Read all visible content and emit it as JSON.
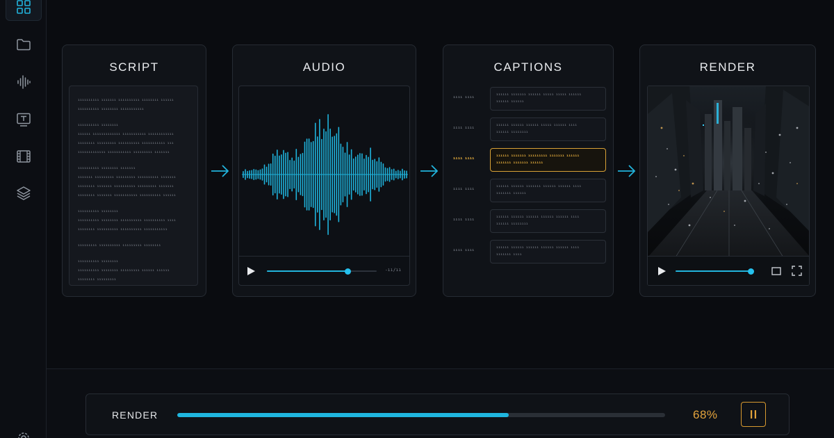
{
  "sidebar": {
    "icons": [
      "grid-icon",
      "folder-icon",
      "waveform-icon",
      "text-icon",
      "film-icon",
      "layers-icon",
      "gear-icon"
    ]
  },
  "stages": {
    "script": {
      "title": "SCRIPT",
      "lines": [
        "ıııııııııı ııııııı ıııııııııı ıııııııı ıııııı",
        "ıııııııııı ıııııııı ııııııııııı",
        "",
        "ıııııııııı ıııııııı",
        "ıııııı ııııııııııııı ııııııııııı ıııııııııııı",
        "ıııııııı ııııııııı ıııııııııı ııııııııııı ııı",
        "ııııııııııııı ııııııııııı ııııııııı ııııııı",
        "",
        "ıııııııııı ıııııııı ııııııı",
        "ııııııı ııııııııı ııııııııı ıııııııııı ııııııı",
        "ıııııııı ııııııı ıııııııııı ııııııııı ııııııı",
        "ıııııııı ııııııı ııııııııııı ıııııııııı ıııııı",
        "",
        "ıııııııııı ıııııııı",
        "ıııııııııı ıııııııı ıııııııııı ıııııııııı ıııı",
        "ıııııııı ıııııııııı ıııııııııı ııııııııııı",
        "",
        "ııııııııı ıııııııııı ııııııııı ıııııııı",
        "",
        "ıııııııııı ıııııııı",
        "ıııııııııı ıııııııı ııııııııı ıııııı ıııııı",
        "ıııııııı ııııııııı"
      ]
    },
    "audio": {
      "title": "AUDIO",
      "time": "-ıı/ıı",
      "progress": 0.74
    },
    "captions": {
      "title": "CAPTIONS",
      "rows": [
        {
          "ts": "ıııı ıııı",
          "line1": "ıııııı ııııııı ıııııı ııııı ııııı ıııııı",
          "line2": "ıııııı ıııııı",
          "active": false
        },
        {
          "ts": "ıııı ıııı",
          "line1": "ıııııı ıııııı ıııııı ııııı ıııııı ıııı",
          "line2": "ıııııı ıııııııı",
          "active": false
        },
        {
          "ts": "ıııı ıııı",
          "line1": "ıııııı ııııııı ııııııııı ııııııı ıııııı",
          "line2": "ııııııı ııııııı ıııııı",
          "active": true
        },
        {
          "ts": "ıııı ıııı",
          "line1": "ıııııı ıııııı ııııııı ıııııı ıııııı ıııı",
          "line2": "ııııııı ıııııı",
          "active": false
        },
        {
          "ts": "ıııı ıııı",
          "line1": "ıııııı ıııııı ıııııı ıııııı ıııııı ıııı",
          "line2": "ıııııı ıııııııı",
          "active": false
        },
        {
          "ts": "ıııı ıııı",
          "line1": "ıııııı ıııııı ıııııı ıııııı ıııııı ıııı",
          "line2": "ııııııı ıııı",
          "active": false
        }
      ]
    },
    "render": {
      "title": "RENDER",
      "progress": 0.96
    }
  },
  "render_status": {
    "label": "RENDER",
    "percent_text": "68%",
    "progress": 0.68
  },
  "colors": {
    "accent": "#1fb6df",
    "highlight": "#e3a33c"
  }
}
